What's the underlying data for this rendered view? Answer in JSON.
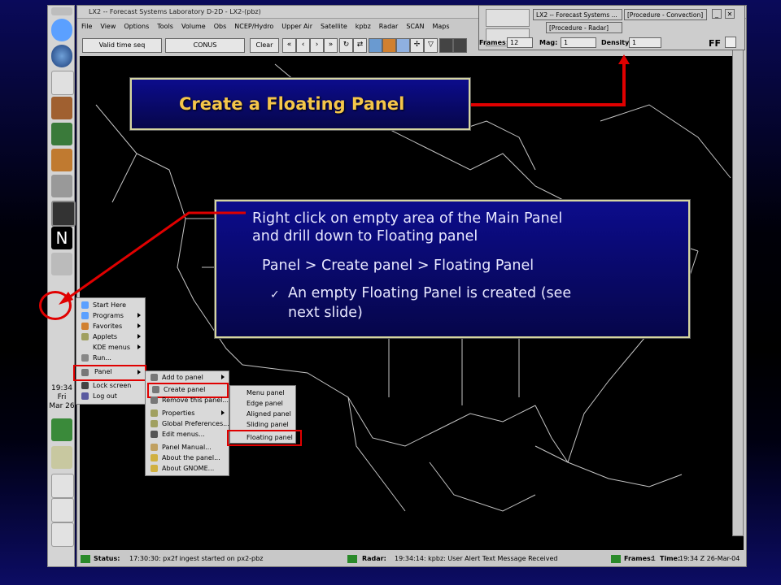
{
  "main_window": {
    "title": "LX2 -- Forecast Systems Laboratory D-2D - LX2-(pbz)",
    "menus": [
      "File",
      "View",
      "Options",
      "Tools",
      "Volume",
      "Obs",
      "NCEP/Hydro",
      "Upper Air",
      "Satellite",
      "kpbz",
      "Radar",
      "SCAN",
      "Maps"
    ],
    "valid_time_label": "Valid time seq",
    "scale_label": "CONUS",
    "clear_label": "Clear"
  },
  "float_window": {
    "title": "LX2 -- Forecast Systems ...",
    "tab_convection": "[Procedure - Convection]",
    "tab_radar": "[Procedure - Radar]",
    "frames_label": "Frames:",
    "frames_value": "12",
    "mag_label": "Mag:",
    "mag_value": "1",
    "density_label": "Density:",
    "density_value": "1",
    "ff_label": "FF"
  },
  "left_panel": {
    "clock_time": "19:34",
    "clock_day": "Fri",
    "clock_date": "Mar 26"
  },
  "callout1": {
    "text": "Create a Floating Panel"
  },
  "callout2": {
    "line1": "Right click on empty area of the Main Panel",
    "line2": "and drill down to Floating panel",
    "line3": "Panel > Create panel > Floating Panel",
    "check": "✓",
    "line4": "An empty Floating Panel is created (see",
    "line5": "next slide)"
  },
  "start_menu": {
    "items": [
      "Start Here",
      "Programs",
      "Favorites",
      "Applets",
      "KDE menus",
      "Run...",
      "Panel",
      "Lock screen",
      "Log out"
    ]
  },
  "panel_menu": {
    "items": [
      "Add to panel",
      "Create panel",
      "Remove this panel...",
      "Properties",
      "Global Preferences...",
      "Edit menus...",
      "Panel Manual...",
      "About the panel...",
      "About GNOME..."
    ]
  },
  "create_menu": {
    "items": [
      "Menu panel",
      "Edge panel",
      "Aligned panel",
      "Sliding panel",
      "Floating panel"
    ]
  },
  "statusbar": {
    "status_label": "Status:",
    "status_text": "17:30:30: px2f ingest started on px2-pbz",
    "radar_label": "Radar:",
    "radar_text": "19:34:14: kpbz: User Alert Text Message Received",
    "frames_label": "Frames:",
    "frames_value": "1",
    "time_label": "Time:",
    "time_value": "19:34 Z 26-Mar-04"
  },
  "colors": {
    "accent_red": "#e00000",
    "callout_title": "#f5c64a",
    "callout_bg": "#0c0c8c"
  }
}
